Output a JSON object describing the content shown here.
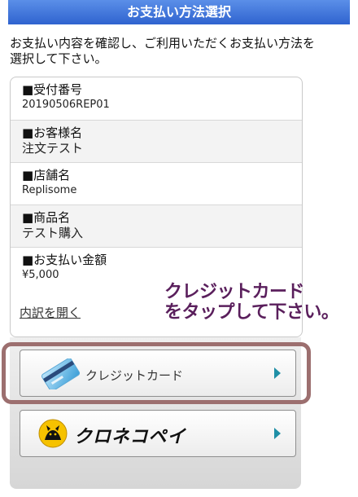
{
  "header": {
    "title": "お支払い方法選択"
  },
  "intro": {
    "text": "お支払い内容を確認し、ご利用いただくお支払い方法を選択して下さい。"
  },
  "order": {
    "fields": [
      {
        "label": "■受付番号",
        "value": "20190506REP01"
      },
      {
        "label": "■お客様名",
        "value": "注文テスト"
      },
      {
        "label": "■店舗名",
        "value": "Replisome"
      },
      {
        "label": "■商品名",
        "value": "テスト購入"
      },
      {
        "label": "■お支払い金額",
        "value": "¥5,000"
      }
    ],
    "detail_link": "内訳を開く"
  },
  "hint": {
    "line1": "クレジットカード",
    "line2": "をタップして下さい。"
  },
  "payment": {
    "credit_card_label": "クレジットカード",
    "kuroneko_label": "クロネコペイ",
    "card_icon": "credit-card-icon",
    "kuroneko_icon": "black-cat-logo-icon",
    "arrow_icon": "chevron-right-icon"
  },
  "colors": {
    "header_bg": "#3b6fd6",
    "hint_text": "#5a1f5c",
    "highlight_border": "#9c6f6f",
    "arrow": "#1f8fa6"
  }
}
